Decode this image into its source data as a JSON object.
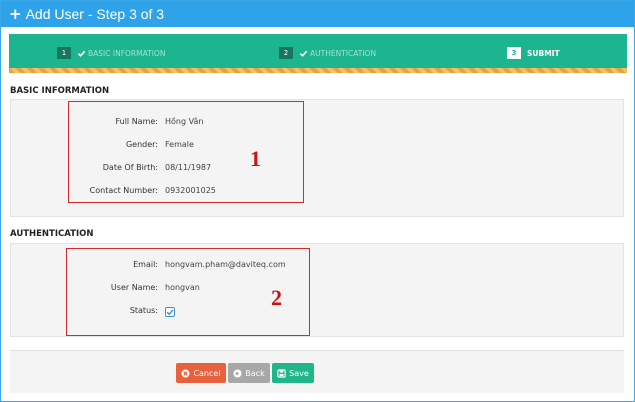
{
  "window": {
    "title": "Add User - Step 3 of 3"
  },
  "wizard": {
    "steps": [
      {
        "number": "1",
        "label": "BASIC INFORMATION",
        "state": "done"
      },
      {
        "number": "2",
        "label": "AUTHENTICATION",
        "state": "done"
      },
      {
        "number": "3",
        "label": "SUBMIT",
        "state": "active"
      }
    ]
  },
  "basic_info": {
    "title": "BASIC INFORMATION",
    "fields": [
      {
        "label": "Full Name:",
        "value": "Hồng Vân"
      },
      {
        "label": "Gender:",
        "value": "Female"
      },
      {
        "label": "Date Of Birth:",
        "value": "08/11/1987"
      },
      {
        "label": "Contact Number:",
        "value": "0932001025"
      }
    ],
    "callout": "1"
  },
  "authentication": {
    "title": "AUTHENTICATION",
    "fields": [
      {
        "label": "Email:",
        "value": "hongvam.pham@daviteq.com"
      },
      {
        "label": "User Name:",
        "value": "hongvan"
      }
    ],
    "status_label": "Status:",
    "status_checked": true,
    "callout": "2"
  },
  "actions": {
    "cancel_label": "Cancel",
    "back_label": "Back",
    "save_label": "Save"
  },
  "colors": {
    "titlebar": "#2ea3ea",
    "wizard": "#1db58f",
    "cancel": "#e8603c",
    "back": "#a7a7a7",
    "save": "#20b68a",
    "callout": "#d01010"
  }
}
